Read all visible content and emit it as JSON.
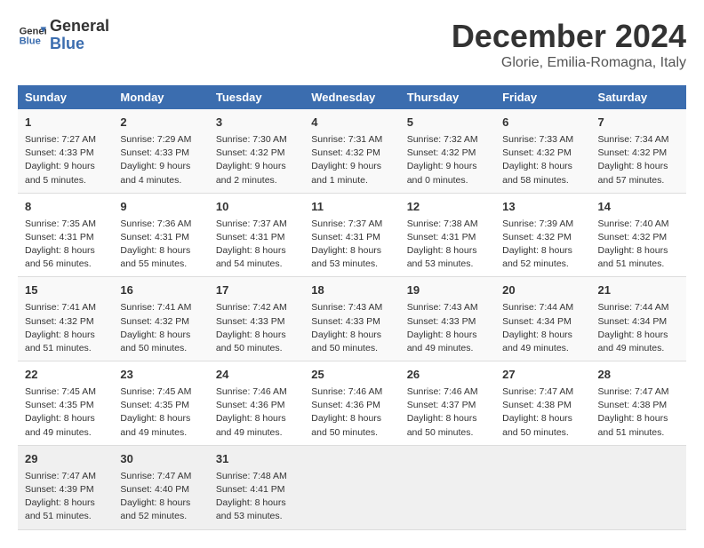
{
  "header": {
    "logo_line1": "General",
    "logo_line2": "Blue",
    "month": "December 2024",
    "location": "Glorie, Emilia-Romagna, Italy"
  },
  "days_of_week": [
    "Sunday",
    "Monday",
    "Tuesday",
    "Wednesday",
    "Thursday",
    "Friday",
    "Saturday"
  ],
  "weeks": [
    [
      {
        "day": "1",
        "info": "Sunrise: 7:27 AM\nSunset: 4:33 PM\nDaylight: 9 hours\nand 5 minutes."
      },
      {
        "day": "2",
        "info": "Sunrise: 7:29 AM\nSunset: 4:33 PM\nDaylight: 9 hours\nand 4 minutes."
      },
      {
        "day": "3",
        "info": "Sunrise: 7:30 AM\nSunset: 4:32 PM\nDaylight: 9 hours\nand 2 minutes."
      },
      {
        "day": "4",
        "info": "Sunrise: 7:31 AM\nSunset: 4:32 PM\nDaylight: 9 hours\nand 1 minute."
      },
      {
        "day": "5",
        "info": "Sunrise: 7:32 AM\nSunset: 4:32 PM\nDaylight: 9 hours\nand 0 minutes."
      },
      {
        "day": "6",
        "info": "Sunrise: 7:33 AM\nSunset: 4:32 PM\nDaylight: 8 hours\nand 58 minutes."
      },
      {
        "day": "7",
        "info": "Sunrise: 7:34 AM\nSunset: 4:32 PM\nDaylight: 8 hours\nand 57 minutes."
      }
    ],
    [
      {
        "day": "8",
        "info": "Sunrise: 7:35 AM\nSunset: 4:31 PM\nDaylight: 8 hours\nand 56 minutes."
      },
      {
        "day": "9",
        "info": "Sunrise: 7:36 AM\nSunset: 4:31 PM\nDaylight: 8 hours\nand 55 minutes."
      },
      {
        "day": "10",
        "info": "Sunrise: 7:37 AM\nSunset: 4:31 PM\nDaylight: 8 hours\nand 54 minutes."
      },
      {
        "day": "11",
        "info": "Sunrise: 7:37 AM\nSunset: 4:31 PM\nDaylight: 8 hours\nand 53 minutes."
      },
      {
        "day": "12",
        "info": "Sunrise: 7:38 AM\nSunset: 4:31 PM\nDaylight: 8 hours\nand 53 minutes."
      },
      {
        "day": "13",
        "info": "Sunrise: 7:39 AM\nSunset: 4:32 PM\nDaylight: 8 hours\nand 52 minutes."
      },
      {
        "day": "14",
        "info": "Sunrise: 7:40 AM\nSunset: 4:32 PM\nDaylight: 8 hours\nand 51 minutes."
      }
    ],
    [
      {
        "day": "15",
        "info": "Sunrise: 7:41 AM\nSunset: 4:32 PM\nDaylight: 8 hours\nand 51 minutes."
      },
      {
        "day": "16",
        "info": "Sunrise: 7:41 AM\nSunset: 4:32 PM\nDaylight: 8 hours\nand 50 minutes."
      },
      {
        "day": "17",
        "info": "Sunrise: 7:42 AM\nSunset: 4:33 PM\nDaylight: 8 hours\nand 50 minutes."
      },
      {
        "day": "18",
        "info": "Sunrise: 7:43 AM\nSunset: 4:33 PM\nDaylight: 8 hours\nand 50 minutes."
      },
      {
        "day": "19",
        "info": "Sunrise: 7:43 AM\nSunset: 4:33 PM\nDaylight: 8 hours\nand 49 minutes."
      },
      {
        "day": "20",
        "info": "Sunrise: 7:44 AM\nSunset: 4:34 PM\nDaylight: 8 hours\nand 49 minutes."
      },
      {
        "day": "21",
        "info": "Sunrise: 7:44 AM\nSunset: 4:34 PM\nDaylight: 8 hours\nand 49 minutes."
      }
    ],
    [
      {
        "day": "22",
        "info": "Sunrise: 7:45 AM\nSunset: 4:35 PM\nDaylight: 8 hours\nand 49 minutes."
      },
      {
        "day": "23",
        "info": "Sunrise: 7:45 AM\nSunset: 4:35 PM\nDaylight: 8 hours\nand 49 minutes."
      },
      {
        "day": "24",
        "info": "Sunrise: 7:46 AM\nSunset: 4:36 PM\nDaylight: 8 hours\nand 49 minutes."
      },
      {
        "day": "25",
        "info": "Sunrise: 7:46 AM\nSunset: 4:36 PM\nDaylight: 8 hours\nand 50 minutes."
      },
      {
        "day": "26",
        "info": "Sunrise: 7:46 AM\nSunset: 4:37 PM\nDaylight: 8 hours\nand 50 minutes."
      },
      {
        "day": "27",
        "info": "Sunrise: 7:47 AM\nSunset: 4:38 PM\nDaylight: 8 hours\nand 50 minutes."
      },
      {
        "day": "28",
        "info": "Sunrise: 7:47 AM\nSunset: 4:38 PM\nDaylight: 8 hours\nand 51 minutes."
      }
    ],
    [
      {
        "day": "29",
        "info": "Sunrise: 7:47 AM\nSunset: 4:39 PM\nDaylight: 8 hours\nand 51 minutes."
      },
      {
        "day": "30",
        "info": "Sunrise: 7:47 AM\nSunset: 4:40 PM\nDaylight: 8 hours\nand 52 minutes."
      },
      {
        "day": "31",
        "info": "Sunrise: 7:48 AM\nSunset: 4:41 PM\nDaylight: 8 hours\nand 53 minutes."
      },
      {
        "day": "",
        "info": ""
      },
      {
        "day": "",
        "info": ""
      },
      {
        "day": "",
        "info": ""
      },
      {
        "day": "",
        "info": ""
      }
    ]
  ]
}
